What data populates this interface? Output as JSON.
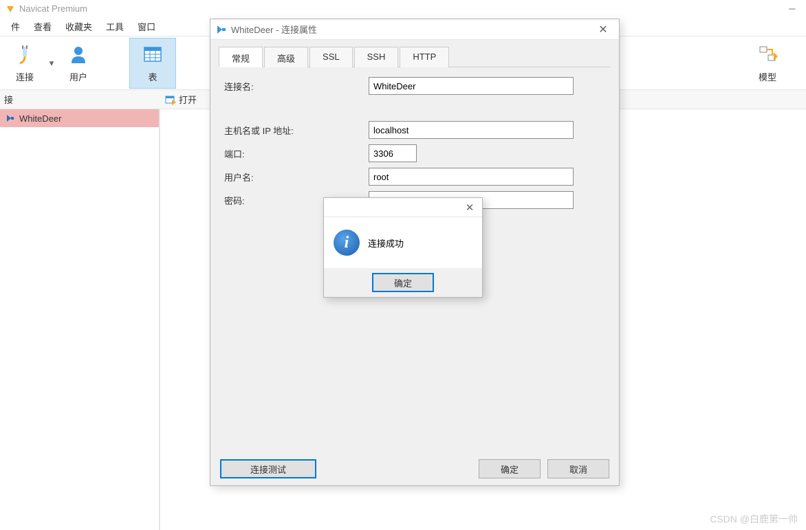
{
  "app_title": "Navicat Premium",
  "menubar": [
    "件",
    "查看",
    "收藏夹",
    "工具",
    "窗口"
  ],
  "toolbar": {
    "connect": "连接",
    "user": "用户",
    "table": "表",
    "model": "模型"
  },
  "subbar": {
    "left": "接",
    "open": "打开"
  },
  "sidebar": {
    "items": [
      {
        "label": "WhiteDeer"
      }
    ]
  },
  "dialog": {
    "title": "WhiteDeer - 连接属性",
    "tabs": [
      "常规",
      "高级",
      "SSL",
      "SSH",
      "HTTP"
    ],
    "labels": {
      "conn_name": "连接名:",
      "host": "主机名或 IP 地址:",
      "port": "端口:",
      "username": "用户名:",
      "password": "密码:"
    },
    "values": {
      "conn_name": "WhiteDeer",
      "host": "localhost",
      "port": "3306",
      "username": "root",
      "password": "•••••••"
    },
    "buttons": {
      "test": "连接测试",
      "ok": "确定",
      "cancel": "取消"
    }
  },
  "msgbox": {
    "text": "连接成功",
    "ok": "确定"
  },
  "watermark": "CSDN @白鹿第一帅"
}
